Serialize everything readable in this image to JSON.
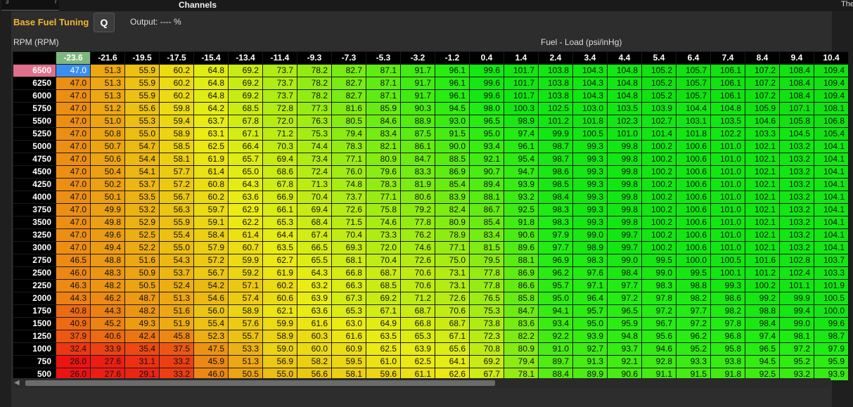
{
  "topbar": {
    "title": "Channels",
    "right_text": "The",
    "mini_left": "3",
    "mini_right": "r"
  },
  "header": {
    "title": "Base Fuel Tuning",
    "search_button": "Q",
    "output_text": "Output: ---- %"
  },
  "axes": {
    "rpm_label": "RPM (RPM)",
    "load_label": "Fuel - Load (psi/inHg)"
  },
  "table": {
    "columns": [
      "-23.6",
      "-21.6",
      "-19.5",
      "-17.5",
      "-15.4",
      "-13.4",
      "-11.4",
      "-9.3",
      "-7.3",
      "-5.3",
      "-3.2",
      "-1.2",
      "0.4",
      "1.4",
      "2.4",
      "3.4",
      "4.4",
      "5.4",
      "6.4",
      "7.4",
      "8.4",
      "9.4",
      "10.4"
    ],
    "rows": [
      {
        "rpm": "6500",
        "values": [
          "47.0",
          "51.3",
          "55.9",
          "60.2",
          "64.8",
          "69.2",
          "73.7",
          "78.2",
          "82.7",
          "87.1",
          "91.7",
          "96.1",
          "99.6",
          "101.7",
          "103.8",
          "104.3",
          "104.8",
          "105.2",
          "105.7",
          "106.1",
          "107.2",
          "108.4",
          "109.4"
        ]
      },
      {
        "rpm": "6250",
        "values": [
          "47.0",
          "51.3",
          "55.9",
          "60.2",
          "64.8",
          "69.2",
          "73.7",
          "78.2",
          "82.7",
          "87.1",
          "91.7",
          "96.1",
          "99.6",
          "101.7",
          "103.8",
          "104.3",
          "104.8",
          "105.2",
          "105.7",
          "106.1",
          "107.2",
          "108.4",
          "109.4"
        ]
      },
      {
        "rpm": "6000",
        "values": [
          "47.0",
          "51.3",
          "55.9",
          "60.2",
          "64.8",
          "69.2",
          "73.7",
          "78.2",
          "82.7",
          "87.1",
          "91.7",
          "96.1",
          "99.6",
          "101.7",
          "103.8",
          "104.3",
          "104.8",
          "105.2",
          "105.7",
          "106.1",
          "107.2",
          "108.4",
          "109.4"
        ]
      },
      {
        "rpm": "5750",
        "values": [
          "47.0",
          "51.2",
          "55.6",
          "59.8",
          "64.2",
          "68.5",
          "72.8",
          "77.3",
          "81.6",
          "85.9",
          "90.3",
          "94.5",
          "98.0",
          "100.3",
          "102.5",
          "103.0",
          "103.5",
          "103.9",
          "104.4",
          "104.8",
          "105.9",
          "107.1",
          "108.1"
        ]
      },
      {
        "rpm": "5500",
        "values": [
          "47.0",
          "51.0",
          "55.3",
          "59.4",
          "63.7",
          "67.8",
          "72.0",
          "76.3",
          "80.5",
          "84.6",
          "88.9",
          "93.0",
          "96.5",
          "98.9",
          "101.2",
          "101.8",
          "102.3",
          "102.7",
          "103.1",
          "103.5",
          "104.6",
          "105.8",
          "106.8"
        ]
      },
      {
        "rpm": "5250",
        "values": [
          "47.0",
          "50.8",
          "55.0",
          "58.9",
          "63.1",
          "67.1",
          "71.2",
          "75.3",
          "79.4",
          "83.4",
          "87.5",
          "91.5",
          "95.0",
          "97.4",
          "99.9",
          "100.5",
          "101.0",
          "101.4",
          "101.8",
          "102.2",
          "103.3",
          "104.5",
          "105.4"
        ]
      },
      {
        "rpm": "5000",
        "values": [
          "47.0",
          "50.7",
          "54.7",
          "58.5",
          "62.5",
          "66.4",
          "70.3",
          "74.4",
          "78.3",
          "82.1",
          "86.1",
          "90.0",
          "93.4",
          "96.1",
          "98.7",
          "99.3",
          "99.8",
          "100.2",
          "100.6",
          "101.0",
          "102.1",
          "103.2",
          "104.1"
        ]
      },
      {
        "rpm": "4750",
        "values": [
          "47.0",
          "50.6",
          "54.4",
          "58.1",
          "61.9",
          "65.7",
          "69.4",
          "73.4",
          "77.1",
          "80.9",
          "84.7",
          "88.5",
          "92.1",
          "95.4",
          "98.7",
          "99.3",
          "99.8",
          "100.2",
          "100.6",
          "101.0",
          "102.1",
          "103.2",
          "104.1"
        ]
      },
      {
        "rpm": "4500",
        "values": [
          "47.0",
          "50.4",
          "54.1",
          "57.7",
          "61.4",
          "65.0",
          "68.6",
          "72.4",
          "76.0",
          "79.6",
          "83.3",
          "86.9",
          "90.7",
          "94.7",
          "98.6",
          "99.3",
          "99.8",
          "100.2",
          "100.6",
          "101.0",
          "102.1",
          "103.2",
          "104.1"
        ]
      },
      {
        "rpm": "4250",
        "values": [
          "47.0",
          "50.2",
          "53.7",
          "57.2",
          "60.8",
          "64.3",
          "67.8",
          "71.3",
          "74.8",
          "78.3",
          "81.9",
          "85.4",
          "89.4",
          "93.9",
          "98.5",
          "99.3",
          "99.8",
          "100.2",
          "100.6",
          "101.0",
          "102.1",
          "103.2",
          "104.1"
        ]
      },
      {
        "rpm": "4000",
        "values": [
          "47.0",
          "50.1",
          "53.5",
          "56.7",
          "60.2",
          "63.6",
          "66.9",
          "70.4",
          "73.7",
          "77.1",
          "80.6",
          "83.9",
          "88.1",
          "93.2",
          "98.4",
          "99.3",
          "99.8",
          "100.2",
          "100.6",
          "101.0",
          "102.1",
          "103.2",
          "104.1"
        ]
      },
      {
        "rpm": "3750",
        "values": [
          "47.0",
          "49.9",
          "53.2",
          "56.3",
          "59.7",
          "62.9",
          "66.1",
          "69.4",
          "72.6",
          "75.8",
          "79.2",
          "82.4",
          "86.7",
          "92.5",
          "98.3",
          "99.3",
          "99.8",
          "100.2",
          "100.6",
          "101.0",
          "102.1",
          "103.2",
          "104.1"
        ]
      },
      {
        "rpm": "3500",
        "values": [
          "47.0",
          "49.8",
          "52.9",
          "55.9",
          "59.1",
          "62.2",
          "65.3",
          "68.4",
          "71.5",
          "74.6",
          "77.8",
          "80.9",
          "85.4",
          "91.8",
          "98.3",
          "99.3",
          "99.8",
          "100.2",
          "100.6",
          "101.0",
          "102.1",
          "103.2",
          "104.1"
        ]
      },
      {
        "rpm": "3250",
        "values": [
          "47.0",
          "49.6",
          "52.5",
          "55.4",
          "58.4",
          "61.4",
          "64.4",
          "67.4",
          "70.4",
          "73.3",
          "76.2",
          "78.9",
          "83.4",
          "90.6",
          "97.9",
          "99.0",
          "99.7",
          "100.2",
          "100.6",
          "101.0",
          "102.1",
          "103.2",
          "104.1"
        ]
      },
      {
        "rpm": "3000",
        "values": [
          "47.0",
          "49.4",
          "52.2",
          "55.0",
          "57.9",
          "60.7",
          "63.5",
          "66.5",
          "69.3",
          "72.0",
          "74.6",
          "77.1",
          "81.5",
          "89.6",
          "97.7",
          "98.9",
          "99.7",
          "100.2",
          "100.6",
          "101.0",
          "102.1",
          "103.2",
          "104.1"
        ]
      },
      {
        "rpm": "2750",
        "values": [
          "46.5",
          "48.8",
          "51.6",
          "54.3",
          "57.2",
          "59.9",
          "62.7",
          "65.5",
          "68.1",
          "70.4",
          "72.6",
          "75.0",
          "79.5",
          "88.1",
          "96.9",
          "98.3",
          "99.0",
          "99.5",
          "100.0",
          "100.5",
          "101.6",
          "102.8",
          "103.7"
        ]
      },
      {
        "rpm": "2500",
        "values": [
          "46.0",
          "48.3",
          "50.9",
          "53.7",
          "56.7",
          "59.2",
          "61.9",
          "64.3",
          "66.8",
          "68.7",
          "70.6",
          "73.1",
          "77.8",
          "86.9",
          "96.2",
          "97.6",
          "98.4",
          "99.0",
          "99.5",
          "100.1",
          "101.2",
          "102.4",
          "103.3"
        ]
      },
      {
        "rpm": "2250",
        "values": [
          "46.3",
          "48.2",
          "50.5",
          "52.4",
          "54.2",
          "57.1",
          "60.2",
          "63.2",
          "66.3",
          "68.5",
          "70.6",
          "73.1",
          "77.8",
          "86.6",
          "95.7",
          "97.1",
          "97.7",
          "98.3",
          "98.8",
          "99.3",
          "100.2",
          "101.1",
          "101.9"
        ]
      },
      {
        "rpm": "2000",
        "values": [
          "44.3",
          "46.2",
          "48.7",
          "51.3",
          "54.6",
          "57.4",
          "60.6",
          "63.9",
          "67.3",
          "69.2",
          "71.2",
          "72.6",
          "76.5",
          "85.8",
          "95.0",
          "96.4",
          "97.2",
          "97.8",
          "98.2",
          "98.6",
          "99.2",
          "99.9",
          "100.5"
        ]
      },
      {
        "rpm": "1750",
        "values": [
          "40.8",
          "44.3",
          "48.2",
          "51.6",
          "56.0",
          "58.9",
          "62.1",
          "63.6",
          "65.3",
          "67.1",
          "68.7",
          "70.6",
          "75.3",
          "84.7",
          "94.1",
          "95.7",
          "96.5",
          "97.2",
          "97.7",
          "98.2",
          "98.8",
          "99.4",
          "100.0"
        ]
      },
      {
        "rpm": "1500",
        "values": [
          "40.9",
          "45.2",
          "49.3",
          "51.9",
          "55.4",
          "57.6",
          "59.9",
          "61.6",
          "63.0",
          "64.9",
          "66.8",
          "68.7",
          "73.8",
          "83.6",
          "93.4",
          "95.0",
          "95.9",
          "96.7",
          "97.2",
          "97.8",
          "98.4",
          "99.0",
          "99.6"
        ]
      },
      {
        "rpm": "1250",
        "values": [
          "37.9",
          "40.6",
          "42.4",
          "45.8",
          "52.3",
          "55.7",
          "58.9",
          "60.3",
          "61.6",
          "63.5",
          "65.3",
          "67.1",
          "72.3",
          "82.2",
          "92.2",
          "93.9",
          "94.8",
          "95.6",
          "96.2",
          "96.8",
          "97.4",
          "98.1",
          "98.7"
        ]
      },
      {
        "rpm": "1000",
        "values": [
          "32.4",
          "33.9",
          "35.4",
          "37.5",
          "47.5",
          "53.3",
          "59.0",
          "60.0",
          "60.9",
          "62.5",
          "63.9",
          "65.6",
          "70.8",
          "80.9",
          "91.0",
          "92.7",
          "93.7",
          "94.6",
          "95.2",
          "95.8",
          "96.5",
          "97.2",
          "97.9"
        ]
      },
      {
        "rpm": "750",
        "values": [
          "26.0",
          "27.6",
          "31.1",
          "33.2",
          "45.9",
          "51.3",
          "56.9",
          "58.2",
          "59.5",
          "61.0",
          "62.5",
          "64.1",
          "69.2",
          "79.4",
          "89.7",
          "91.3",
          "92.1",
          "92.8",
          "93.3",
          "93.8",
          "94.5",
          "95.2",
          "95.9"
        ]
      },
      {
        "rpm": "500",
        "values": [
          "26.0",
          "27.6",
          "29.1",
          "33.2",
          "46.0",
          "50.5",
          "55.0",
          "56.6",
          "58.1",
          "59.6",
          "61.1",
          "62.6",
          "67.7",
          "78.1",
          "88.4",
          "89.9",
          "90.6",
          "91.1",
          "91.5",
          "91.8",
          "92.5",
          "93.2",
          "93.9"
        ]
      }
    ]
  },
  "colors": {
    "accent": "#f2b632",
    "selected": "#3a8ef2",
    "active_row": "#e0708a",
    "active_col": "#7fb87f"
  }
}
